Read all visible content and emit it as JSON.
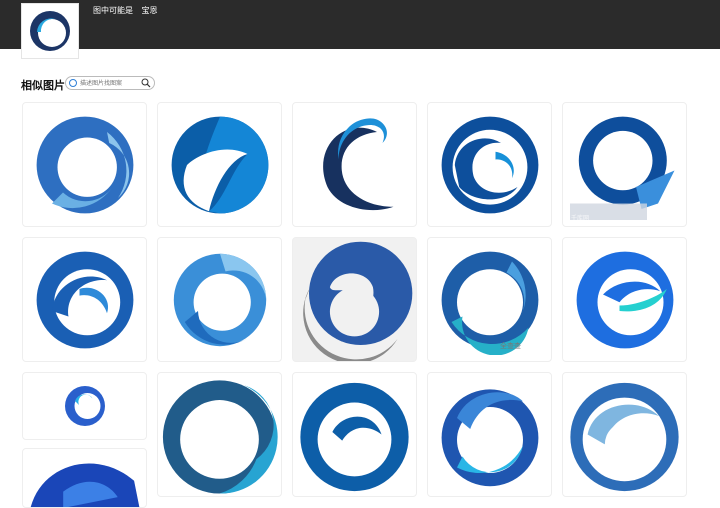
{
  "header": {
    "guess_label": "图中可能是",
    "guess_value": "宝恩"
  },
  "section": {
    "title": "相似图片",
    "search_placeholder": "描述图片找图案"
  },
  "watermarks": {
    "w1": "千库网",
    "w2": "全查查"
  }
}
